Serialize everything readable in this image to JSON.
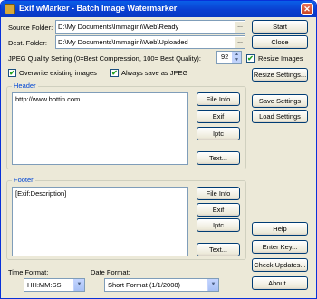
{
  "window": {
    "title": "Exif wMarker - Batch Image Watermarker",
    "close_label": "✕"
  },
  "source": {
    "label": "Source Folder:",
    "value": "D:\\My Documents\\Immagini\\Web\\Ready",
    "browse": "..."
  },
  "dest": {
    "label": "Dest. Folder:",
    "value": "D:\\My Documents\\Immagini\\Web\\Uploaded",
    "browse": "..."
  },
  "jpeg": {
    "label": "JPEG Quality Setting (0=Best Compression, 100= Best Quality):",
    "value": "92"
  },
  "options": {
    "overwrite": "Overwrite existing images",
    "always_jpeg": "Always save as JPEG",
    "resize": "Resize Images",
    "check_mark": "✔"
  },
  "header": {
    "label": "Header",
    "text": "http://www.bottin.com"
  },
  "footer": {
    "label": "Footer",
    "text": "[Exif:Description]"
  },
  "buttons": {
    "start": "Start",
    "close": "Close",
    "resize_settings": "Resize Settings...",
    "save_settings": "Save Settings",
    "load_settings": "Load Settings",
    "file_info": "File Info",
    "exif": "Exif",
    "iptc": "Iptc",
    "text": "Text...",
    "help": "Help",
    "enter_key": "Enter Key...",
    "check_updates": "Check Updates...",
    "about": "About..."
  },
  "time_format": {
    "label": "Time Format:",
    "value": "HH:MM:SS"
  },
  "date_format": {
    "label": "Date Format:",
    "value": "Short Format (1/1/2008)"
  },
  "icons": {
    "dropdown": "▼",
    "spin_up": "▲",
    "spin_down": "▼"
  }
}
